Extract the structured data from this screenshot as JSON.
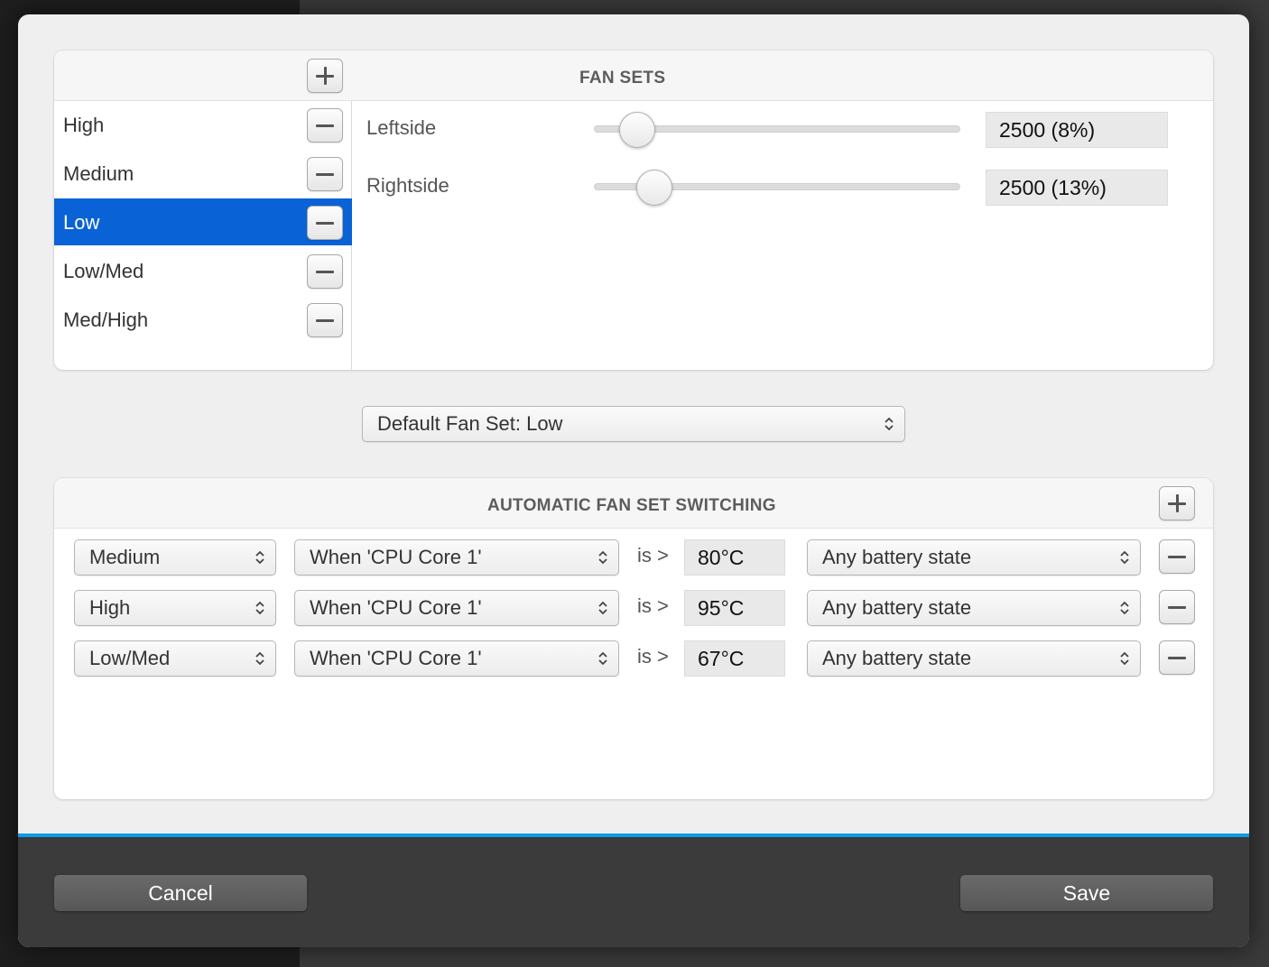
{
  "fan_sets": {
    "title": "FAN SETS",
    "items": [
      {
        "label": "High",
        "selected": false
      },
      {
        "label": "Medium",
        "selected": false
      },
      {
        "label": "Low",
        "selected": true
      },
      {
        "label": "Low/Med",
        "selected": false
      },
      {
        "label": "Med/High",
        "selected": false
      }
    ],
    "fans": [
      {
        "name": "Leftside",
        "value": "2500 (8%)",
        "percent": 8
      },
      {
        "name": "Rightside",
        "value": "2500 (13%)",
        "percent": 13
      }
    ]
  },
  "default_fan_set": {
    "label": "Default Fan Set: Low"
  },
  "auto_switching": {
    "title": "AUTOMATIC FAN SET SWITCHING",
    "operator": "is >",
    "rules": [
      {
        "fan_set": "Medium",
        "sensor": "When 'CPU Core 1'",
        "threshold": "80°C",
        "battery": "Any battery state"
      },
      {
        "fan_set": "High",
        "sensor": "When 'CPU Core 1'",
        "threshold": "95°C",
        "battery": "Any battery state"
      },
      {
        "fan_set": "Low/Med",
        "sensor": "When 'CPU Core 1'",
        "threshold": "67°C",
        "battery": "Any battery state"
      }
    ]
  },
  "footer": {
    "cancel_label": "Cancel",
    "save_label": "Save"
  },
  "colors": {
    "selection": "#0963d6",
    "footer_accent": "#0d9be8",
    "footer_bg": "#3b3b3b"
  }
}
